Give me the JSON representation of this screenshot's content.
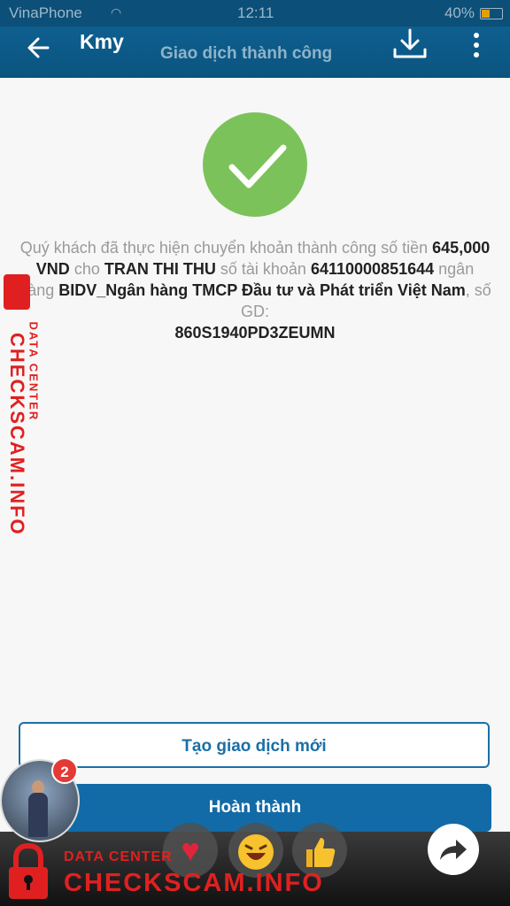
{
  "status": {
    "carrier": "VinaPhone",
    "time": "12:11",
    "battery": "40%"
  },
  "appbar": {
    "title": "Kmy",
    "subtitle": "Giao dịch thành công"
  },
  "message": {
    "line1": "Quý khách đã thực hiện chuyển khoản thành công số tiền",
    "amount": "645,000 VND",
    "cho": "cho",
    "recipient": "TRAN THI THU",
    "so_tai_khoan": "số tài khoản",
    "account": "64110000851644",
    "ngan_hang": "ngân hàng",
    "bank": "BIDV_Ngân hàng TMCP Đầu tư và Phát triển Việt Nam",
    "so_gd": ", số GD:",
    "transaction_id": "860S1940PD3ZEUMN"
  },
  "buttons": {
    "new_transaction": "Tạo giao dịch mới",
    "done": "Hoàn thành"
  },
  "overlay": {
    "notification_count": "2"
  },
  "watermark": {
    "small": "DATA CENTER",
    "big": "CHECKSCAM.INFO"
  },
  "colors": {
    "header": "#0c4f78",
    "success": "#7cc25a",
    "primary": "#126ba6",
    "watermark": "#e02020"
  },
  "icons": [
    "back-arrow-icon",
    "download-icon",
    "more-vertical-icon",
    "checkmark-icon",
    "heart-icon",
    "laugh-emoji-icon",
    "thumbs-up-icon",
    "share-icon",
    "lock-icon"
  ]
}
